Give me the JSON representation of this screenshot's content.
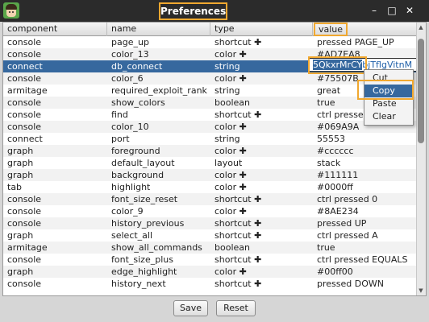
{
  "window": {
    "title": "Preferences",
    "controls": {
      "minimize": "–",
      "maximize": "□",
      "close": "✕"
    }
  },
  "table": {
    "columns": [
      "component",
      "name",
      "type",
      "value"
    ],
    "rows": [
      [
        "console",
        "page_up",
        "shortcut ✚",
        "pressed PAGE_UP"
      ],
      [
        "console",
        "color_13",
        "color ✚",
        "#AD7EA8"
      ],
      [
        "connect",
        "db_connect",
        "string",
        ""
      ],
      [
        "console",
        "color_6",
        "color ✚",
        "#75507B"
      ],
      [
        "armitage",
        "required_exploit_rank",
        "string",
        "great"
      ],
      [
        "console",
        "show_colors",
        "boolean",
        "true"
      ],
      [
        "console",
        "find",
        "shortcut ✚",
        "ctrl pressed F"
      ],
      [
        "console",
        "color_10",
        "color ✚",
        "#069A9A"
      ],
      [
        "connect",
        "port",
        "string",
        "55553"
      ],
      [
        "graph",
        "foreground",
        "color ✚",
        "#cccccc"
      ],
      [
        "graph",
        "default_layout",
        "layout",
        "stack"
      ],
      [
        "graph",
        "background",
        "color ✚",
        "#111111"
      ],
      [
        "tab",
        "highlight",
        "color ✚",
        "#0000ff"
      ],
      [
        "console",
        "font_size_reset",
        "shortcut ✚",
        "ctrl pressed 0"
      ],
      [
        "console",
        "color_9",
        "color ✚",
        "#8AE234"
      ],
      [
        "console",
        "history_previous",
        "shortcut ✚",
        "pressed UP"
      ],
      [
        "graph",
        "select_all",
        "shortcut ✚",
        "ctrl pressed A"
      ],
      [
        "armitage",
        "show_all_commands",
        "boolean",
        "true"
      ],
      [
        "console",
        "font_size_plus",
        "shortcut ✚",
        "ctrl pressed EQUALS"
      ],
      [
        "graph",
        "edge_highlight",
        "color ✚",
        "#00ff00"
      ],
      [
        "console",
        "history_next",
        "shortcut ✚",
        "pressed DOWN"
      ]
    ],
    "selected_row": 2,
    "editor": {
      "selected_text": "5QkxrMrCY",
      "rest_text": "bjTflgVitnM"
    }
  },
  "context_menu": {
    "items": [
      "Cut",
      "Copy",
      "Paste",
      "Clear"
    ],
    "active": 1
  },
  "buttons": {
    "save": "Save",
    "reset": "Reset"
  },
  "colors": {
    "selection": "#36689e",
    "highlight_outline": "#f0a830",
    "titlebar": "#2b2b2b"
  }
}
